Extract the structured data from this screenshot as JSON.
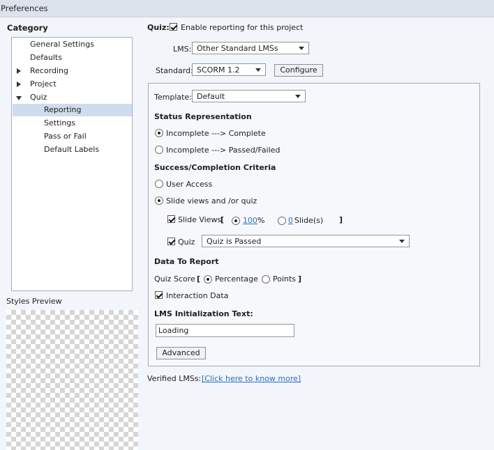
{
  "window": {
    "title": "Preferences"
  },
  "sidebar": {
    "category_title": "Category",
    "items": [
      {
        "label": "General Settings"
      },
      {
        "label": "Defaults"
      },
      {
        "label": "Recording"
      },
      {
        "label": "Project"
      },
      {
        "label": "Quiz"
      },
      {
        "label": "Reporting"
      },
      {
        "label": "Settings"
      },
      {
        "label": "Pass or Fail"
      },
      {
        "label": "Default Labels"
      }
    ],
    "styles_preview_label": "Styles Preview"
  },
  "quiz": {
    "label": "Quiz:",
    "enable_reporting_label": "Enable reporting for this project",
    "enable_reporting_checked": true,
    "lms_label": "LMS:",
    "lms_value": "Other Standard LMSs",
    "standard_label": "Standard:",
    "standard_value": "SCORM 1.2",
    "configure_button": "Configure"
  },
  "panel": {
    "template_label": "Template:",
    "template_value": "Default",
    "status_heading": "Status Representation",
    "status_options": [
      {
        "label": "Incomplete ---> Complete",
        "selected": true
      },
      {
        "label": "Incomplete ---> Passed/Failed",
        "selected": false
      }
    ],
    "criteria_heading": "Success/Completion Criteria",
    "criteria_options": [
      {
        "label": "User Access",
        "selected": false
      },
      {
        "label": "Slide views and /or quiz",
        "selected": true
      }
    ],
    "slide_views": {
      "label": "Slide Views",
      "checked": true,
      "bracket_open": "[",
      "bracket_close": "]",
      "percent_value": "100",
      "percent_unit": "%",
      "percent_selected": true,
      "slides_value": "0",
      "slides_unit": "Slide(s)",
      "slides_selected": false
    },
    "quiz_row": {
      "label": "Quiz",
      "checked": true,
      "value": "Quiz is Passed"
    },
    "data_heading": "Data To Report",
    "quiz_score": {
      "label": "Quiz Score",
      "bracket_open": "[",
      "bracket_close": "]",
      "options": [
        {
          "label": "Percentage",
          "selected": true
        },
        {
          "label": "Points",
          "selected": false
        }
      ]
    },
    "interaction_data": {
      "label": "Interaction Data",
      "checked": true
    },
    "lms_init_heading": "LMS Initialization Text:",
    "lms_init_value": "Loading",
    "advanced_button": "Advanced"
  },
  "footer": {
    "verified_label": "Verified LMSs:",
    "verified_link": "[Click here to know more]"
  }
}
